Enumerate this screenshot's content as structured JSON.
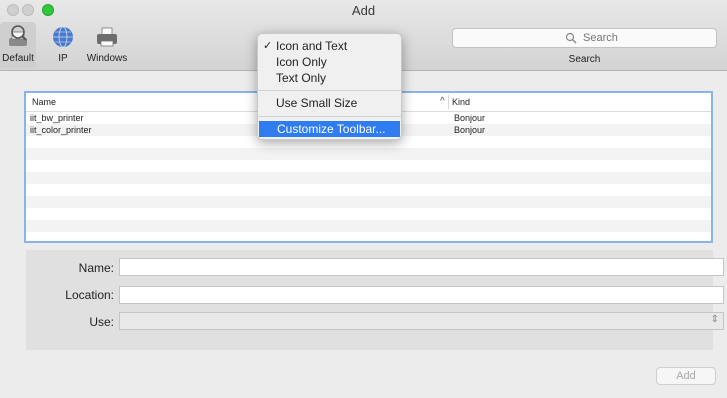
{
  "window": {
    "title": "Add"
  },
  "toolbar": {
    "items": [
      {
        "label": "Default",
        "icon": "default-printer-icon",
        "selected": true
      },
      {
        "label": "IP",
        "icon": "globe-icon",
        "selected": false
      },
      {
        "label": "Windows",
        "icon": "printer-icon",
        "selected": false
      }
    ],
    "search": {
      "placeholder": "Search",
      "label": "Search"
    }
  },
  "printer_list": {
    "columns": {
      "name": "Name",
      "kind": "Kind"
    },
    "rows": [
      {
        "name": "iit_bw_printer",
        "kind": "Bonjour"
      },
      {
        "name": "iit_color_printer",
        "kind": "Bonjour"
      }
    ]
  },
  "form": {
    "name_label": "Name:",
    "location_label": "Location:",
    "use_label": "Use:",
    "name_value": "",
    "location_value": "",
    "use_value": ""
  },
  "buttons": {
    "add": "Add"
  },
  "context_menu": {
    "items": [
      {
        "label": "Icon and Text",
        "checked": true
      },
      {
        "label": "Icon Only",
        "checked": false
      },
      {
        "label": "Text Only",
        "checked": false
      },
      {
        "label": "Use Small Size",
        "checked": false
      },
      {
        "label": "Customize Toolbar...",
        "highlighted": true
      }
    ],
    "checkmark": "✓"
  },
  "colors": {
    "accent": "#2f7bf0",
    "focus_ring": "#8ab4e8",
    "zoom_button": "#2fc73e"
  }
}
